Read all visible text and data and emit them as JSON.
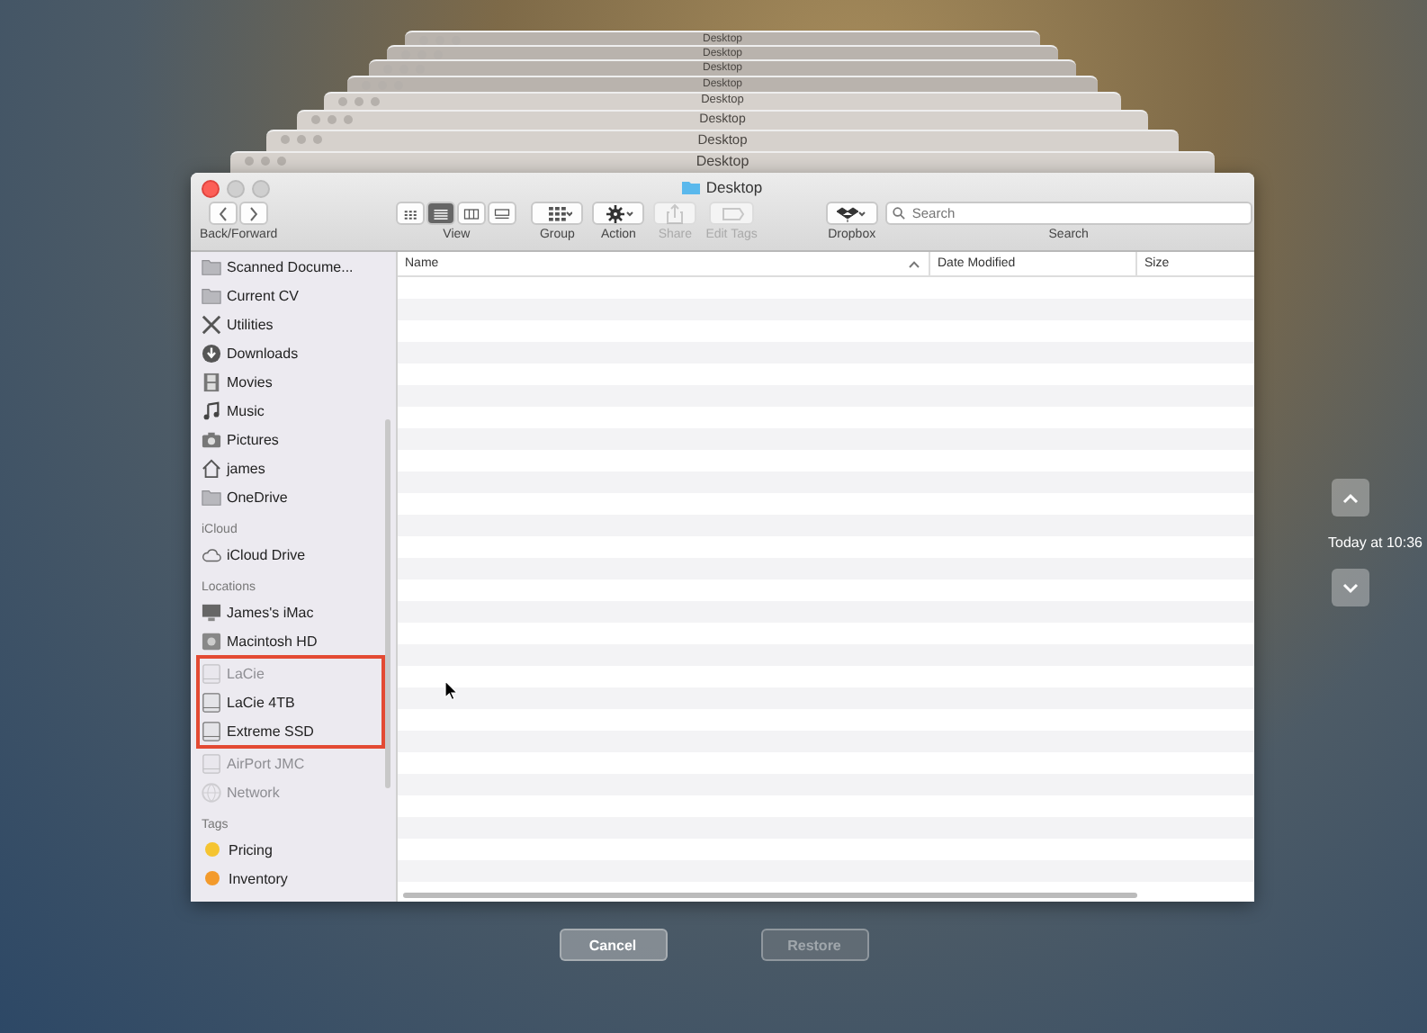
{
  "stack_windows": [
    {
      "title": "Desktop"
    },
    {
      "title": "Desktop"
    },
    {
      "title": "Desktop"
    },
    {
      "title": "Desktop"
    },
    {
      "title": "Desktop"
    },
    {
      "title": "Desktop"
    },
    {
      "title": "Desktop"
    },
    {
      "title": "Desktop"
    }
  ],
  "window": {
    "title": "Desktop"
  },
  "toolbar": {
    "nav_label": "Back/Forward",
    "view": {
      "label": "View",
      "modes": [
        {
          "kind": "icons",
          "selected": false
        },
        {
          "kind": "list",
          "selected": true
        },
        {
          "kind": "columns",
          "selected": false
        },
        {
          "kind": "gallery",
          "selected": false
        }
      ]
    },
    "buttons": [
      {
        "kind": "group",
        "label": "Group",
        "disabled": false
      },
      {
        "kind": "action",
        "label": "Action",
        "disabled": false
      },
      {
        "kind": "share",
        "label": "Share",
        "disabled": true
      },
      {
        "kind": "tags",
        "label": "Edit Tags",
        "disabled": true
      },
      {
        "kind": "dropbox",
        "label": "Dropbox",
        "disabled": false
      }
    ],
    "search": {
      "placeholder": "Search",
      "label": "Search"
    }
  },
  "sidebar": {
    "sections": [
      {
        "items": [
          {
            "label": "Scanned Docume...",
            "kind": "folder",
            "disabled": false,
            "highlighted": false
          },
          {
            "label": "Current CV",
            "kind": "folder",
            "disabled": false,
            "highlighted": false
          },
          {
            "label": "Utilities",
            "kind": "tools",
            "disabled": false,
            "highlighted": false
          },
          {
            "label": "Downloads",
            "kind": "download",
            "disabled": false,
            "highlighted": false
          },
          {
            "label": "Movies",
            "kind": "film",
            "disabled": false,
            "highlighted": false
          },
          {
            "label": "Music",
            "kind": "music",
            "disabled": false,
            "highlighted": false
          },
          {
            "label": "Pictures",
            "kind": "camera",
            "disabled": false,
            "highlighted": false
          },
          {
            "label": "james",
            "kind": "home",
            "disabled": false,
            "highlighted": false
          },
          {
            "label": "OneDrive",
            "kind": "folder",
            "disabled": false,
            "highlighted": false
          }
        ]
      },
      {
        "title": "iCloud",
        "items": [
          {
            "label": "iCloud Drive",
            "kind": "cloud",
            "disabled": false,
            "highlighted": false
          }
        ]
      },
      {
        "title": "Locations",
        "items": [
          {
            "label": "James's iMac",
            "kind": "monitor",
            "disabled": false,
            "highlighted": false
          },
          {
            "label": "Macintosh HD",
            "kind": "disk",
            "disabled": false,
            "highlighted": false
          },
          {
            "label": "LaCie",
            "kind": "drive",
            "disabled": true,
            "highlighted": true
          },
          {
            "label": "LaCie 4TB",
            "kind": "drive",
            "disabled": false,
            "highlighted": true
          },
          {
            "label": "Extreme SSD",
            "kind": "drive",
            "disabled": false,
            "highlighted": true
          },
          {
            "label": "AirPort JMC",
            "kind": "drive",
            "disabled": true,
            "highlighted": false
          },
          {
            "label": "Network",
            "kind": "globe",
            "disabled": true,
            "highlighted": false
          }
        ]
      },
      {
        "title": "Tags",
        "items": [
          {
            "label": "Pricing",
            "kind": "tag",
            "color": "#f5c431",
            "disabled": false,
            "highlighted": false
          },
          {
            "label": "Inventory",
            "kind": "tag",
            "color": "#f39a2b",
            "disabled": false,
            "highlighted": false
          }
        ]
      }
    ]
  },
  "table": {
    "columns": [
      {
        "label": "Name",
        "sorted": true
      },
      {
        "label": "Date Modified",
        "sorted": false
      },
      {
        "label": "Size",
        "sorted": false
      }
    ]
  },
  "timeline": {
    "time": "Today at 10:36"
  },
  "buttons": [
    {
      "label": "Cancel",
      "disabled": false
    },
    {
      "label": "Restore",
      "disabled": true
    }
  ]
}
